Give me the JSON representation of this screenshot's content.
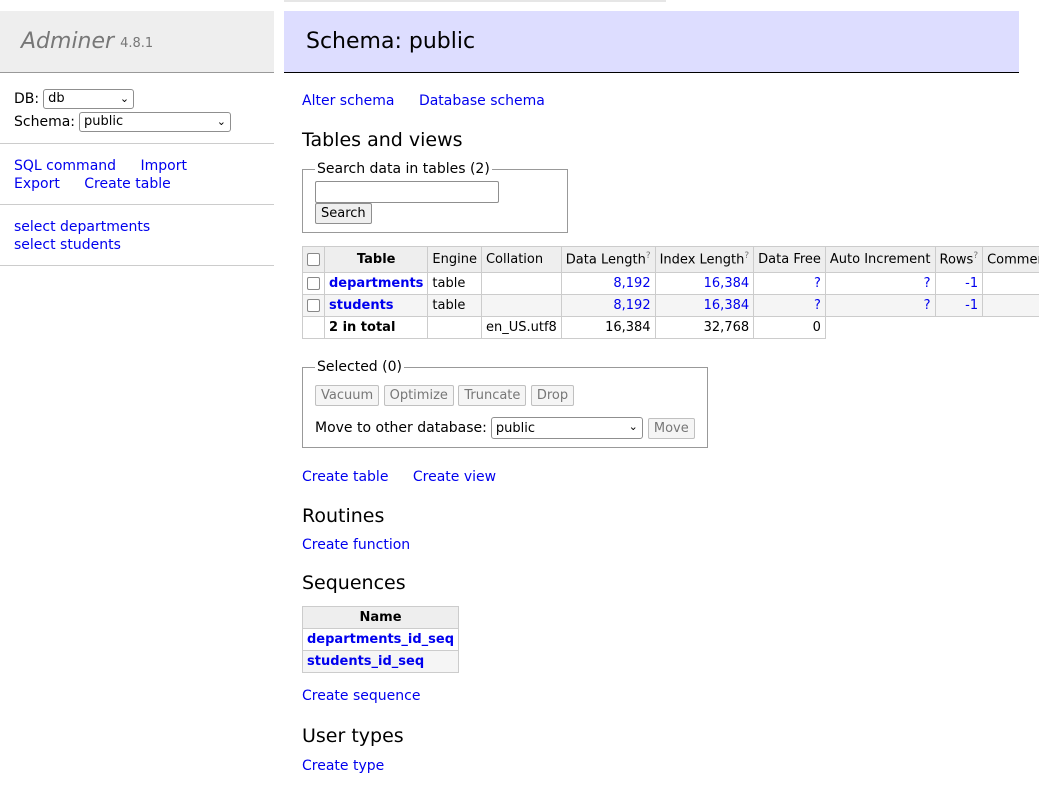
{
  "app": {
    "name": "Adminer",
    "version": "4.8.1"
  },
  "sidebar": {
    "db_label": "DB:",
    "db_value": "db",
    "schema_label": "Schema:",
    "schema_value": "public",
    "links": [
      {
        "label": "SQL command"
      },
      {
        "label": "Import"
      },
      {
        "label": "Export"
      },
      {
        "label": "Create table"
      }
    ],
    "tables": [
      {
        "label": "select departments"
      },
      {
        "label": "select students"
      }
    ]
  },
  "header": {
    "title": "Schema: public"
  },
  "schema_links": {
    "alter": "Alter schema",
    "diagram": "Database schema"
  },
  "tables_section": {
    "title": "Tables and views",
    "search_legend": "Search data in tables (2)",
    "search_button": "Search",
    "columns": [
      "Table",
      "Engine",
      "Collation",
      "Data Length",
      "Index Length",
      "Data Free",
      "Auto Increment",
      "Rows",
      "Comment"
    ],
    "help_mark": "?",
    "rows": [
      {
        "name": "departments",
        "engine": "table",
        "collation": "",
        "data_length": "8,192",
        "index_length": "16,384",
        "data_free": "?",
        "auto_increment": "?",
        "rows": "-1",
        "comment": ""
      },
      {
        "name": "students",
        "engine": "table",
        "collation": "",
        "data_length": "8,192",
        "index_length": "16,384",
        "data_free": "?",
        "auto_increment": "?",
        "rows": "-1",
        "comment": ""
      }
    ],
    "total": {
      "label": "2 in total",
      "collation": "en_US.utf8",
      "data_length": "16,384",
      "index_length": "32,768",
      "data_free": "0"
    }
  },
  "selected": {
    "legend": "Selected (0)",
    "buttons": [
      "Vacuum",
      "Optimize",
      "Truncate",
      "Drop"
    ],
    "move_label": "Move to other database:",
    "move_value": "public",
    "move_button": "Move"
  },
  "create_links": {
    "table": "Create table",
    "view": "Create view"
  },
  "routines": {
    "title": "Routines",
    "create": "Create function"
  },
  "sequences": {
    "title": "Sequences",
    "header": "Name",
    "items": [
      "departments_id_seq",
      "students_id_seq"
    ],
    "create": "Create sequence"
  },
  "user_types": {
    "title": "User types",
    "create": "Create type"
  }
}
